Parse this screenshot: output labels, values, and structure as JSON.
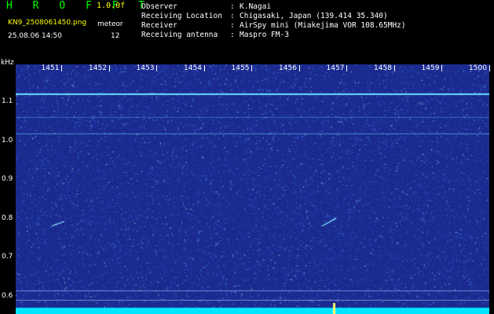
{
  "header": {
    "logo": "H R O F F T",
    "version": "1.0.0f",
    "filename": "KN9_2508061450.png",
    "meteor_label": "meteor",
    "date": "25.08.06 14:50",
    "meteor_count": "12"
  },
  "info": [
    {
      "key": "Observer",
      "value": "K.Nagai"
    },
    {
      "key": "Receiving Location",
      "value": "Chigasaki, Japan (139.414 35.340)"
    },
    {
      "key": "Receiver",
      "value": "AirSpy mini (Miakejima VOR 108.65MHz)"
    },
    {
      "key": "Receiving antenna",
      "value": "Maspro FM-3"
    }
  ],
  "axis": {
    "unit": "kHz",
    "y_ticks": [
      "1.1",
      "1.0",
      "0.9",
      "0.8",
      "0.7",
      "0.6"
    ],
    "x_ticks": [
      "1451",
      "1452",
      "1453",
      "1454",
      "1455",
      "1456",
      "1457",
      "1458",
      "1459",
      "1500"
    ]
  },
  "colors": {
    "background": "#1a2a8f",
    "carrier": "#66e0ff",
    "bottom_band": "#00e5ff"
  }
}
